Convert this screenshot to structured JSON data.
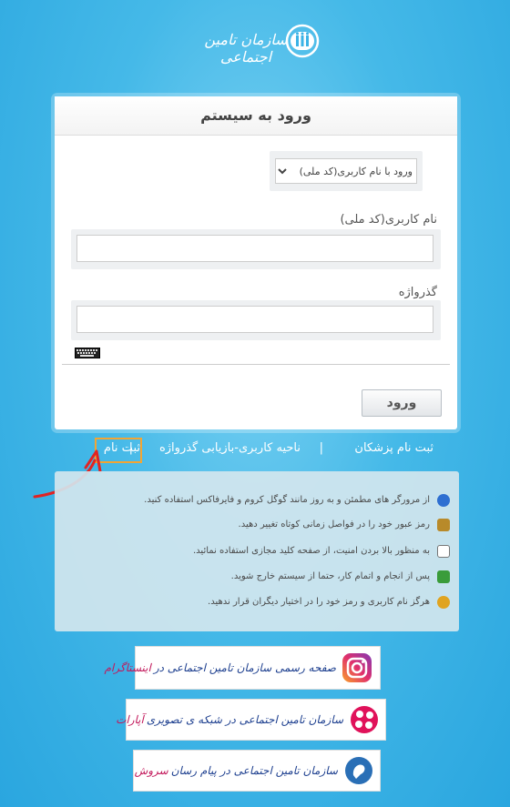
{
  "header": {
    "org_name": "سازمان تامین اجتماعی"
  },
  "login": {
    "title": "ورود به سیستم",
    "method_selected": "ورود با نام کاربری(کد ملی)",
    "username_label": "نام کاربری(کد ملی)",
    "username_value": "",
    "password_label": "گذرواژه",
    "password_value": "",
    "submit_label": "ورود"
  },
  "links": {
    "doctor_register": "ثبت نام پزشکان",
    "sep1": "|",
    "user_area": "ناحیه کاربری-بازیابی گذرواژه",
    "sep2": "|",
    "register": "ثبت نام"
  },
  "tips": [
    {
      "icon": "browser-icon",
      "text": "از مرورگر های مطمئن و به روز مانند گوگل کروم و فایرفاکس استفاده کنید."
    },
    {
      "icon": "key-icon",
      "text": "رمز عبور خود را در فواصل زمانی کوتاه تغییر دهید."
    },
    {
      "icon": "virtual-keyboard-icon",
      "text": "به منظور بالا بردن امنیت، از صفحه کلید مجازی استفاده نمائید."
    },
    {
      "icon": "exit-icon",
      "text": "پس از انجام و اتمام کار، حتما از سیستم خارج شوید."
    },
    {
      "icon": "privacy-icon",
      "text": "هرگز نام کاربری و رمز خود را در اختیار دیگران قرار ندهید."
    }
  ],
  "banners": [
    {
      "icon": "instagram-icon",
      "text": "صفحه رسمی سازمان تامین اجتماعی در",
      "accent": "اینستاگرام"
    },
    {
      "icon": "aparat-icon",
      "text": "سازمان تامین اجتماعی در شبکه ی تصویری",
      "accent": "آپارات"
    },
    {
      "icon": "soroush-icon",
      "text": "سازمان تامین اجتماعی در پیام رسان",
      "accent": "سروش"
    }
  ]
}
